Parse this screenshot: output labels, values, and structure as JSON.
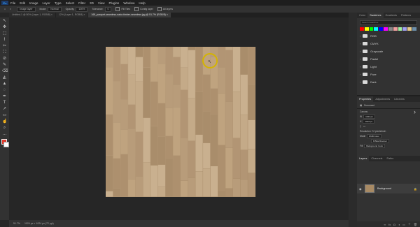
{
  "app": {
    "logo": "Ps"
  },
  "menu": [
    "File",
    "Edit",
    "Image",
    "Layer",
    "Type",
    "Select",
    "Filter",
    "3D",
    "View",
    "Plugins",
    "Window",
    "Help"
  ],
  "options": {
    "preset": "Image layer",
    "mode_label": "Mode:",
    "mode": "Normal",
    "opacity_label": "Opacity:",
    "opacity": "100%",
    "tolerance_label": "Tolerance:",
    "tolerance": "0",
    "fill_label": "Fill Tiles",
    "config_label": "Config layer",
    "all_layers_label": "All layers"
  },
  "tabs": [
    {
      "label": "Untitled-1 @ 50% (Layer 1, RGB/8) ×"
    },
    {
      "label": "12% (Layer 1, RGB/8) ×"
    },
    {
      "label": "165_parquet-seamless-natur-timber-seamless.jpg @ 51.7% (RGB/8) ×"
    }
  ],
  "tools": [
    "↖",
    "✥",
    "⬚",
    "⌇",
    "✂",
    "⛶",
    "⊘",
    "✎",
    "⌫",
    "◭",
    "▲",
    "◌",
    "✒",
    "T",
    "↗",
    "▭",
    "☝",
    "⌕",
    "…"
  ],
  "colors": {
    "fg": "#e0392a",
    "bg": "#ffffff",
    "accent": "#d4b400"
  },
  "status": {
    "zoom": "51.7%",
    "doc": "1024 px × 1024 px (72 ppi)"
  },
  "panels": {
    "top_tabs": [
      "Color",
      "Swatches",
      "Gradients",
      "Patterns"
    ],
    "search": "Search Swatches",
    "swatch_colors": [
      "#ff0000",
      "#ffff00",
      "#00ff00",
      "#00ffff",
      "#0000ff",
      "#ff00ff",
      "#888888",
      "#f0a0a0",
      "#a0f0a0",
      "#a0a0f0",
      "#e6c98a",
      "#6c8ea8"
    ],
    "folders": [
      "RGB",
      "CMYK",
      "Grayscale",
      "Pastel",
      "Light",
      "Pure",
      "Dark"
    ],
    "props_tabs": [
      "Properties",
      "Adjustments",
      "Libraries"
    ],
    "props_doc": "Document",
    "canvas_label": "Canvas",
    "w_label": "W",
    "w": "1024 px",
    "h_label": "H",
    "h": "1024 px",
    "resolution": "Resolution: 72 pixels/inch",
    "mode_label": "Mode",
    "mode": "RGB Color",
    "depth": "8 Bits/Channel",
    "fill_label": "Fill",
    "fill": "Background Color",
    "layers_tabs": [
      "Layers",
      "Channels",
      "Paths"
    ],
    "layer_name": "Background"
  }
}
